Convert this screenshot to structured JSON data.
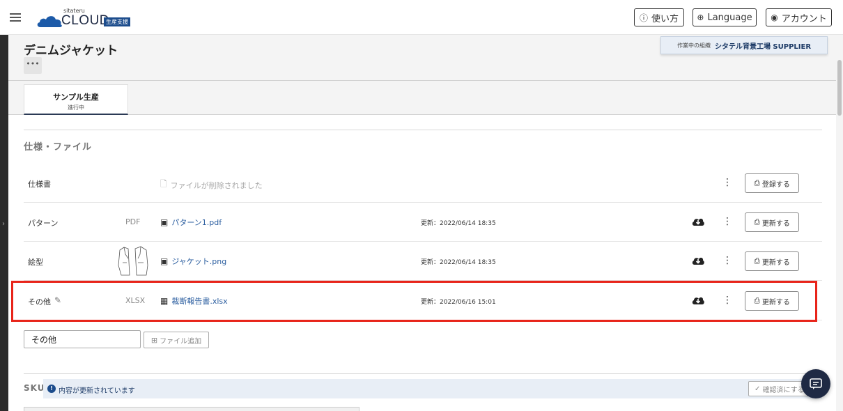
{
  "header": {
    "brand_small": "sitateru",
    "brand": "CLOUD",
    "badge": "生産支援",
    "help_label": "使い方",
    "language_label": "Language",
    "account_label": "アカウント"
  },
  "page": {
    "title": "デニムジャケット",
    "more_label": "•••",
    "org_label": "作業中の組織",
    "org_name": "シタテル背景工場 SUPPLIER"
  },
  "tabs": [
    {
      "label": "サンプル生産",
      "sub": "進行中"
    }
  ],
  "spec_section": {
    "title": "仕様・ファイル",
    "rows": [
      {
        "name": "仕様書",
        "type": "",
        "file": "ファイルが削除されました",
        "date": "",
        "button": "登録する"
      },
      {
        "name": "パターン",
        "type": "PDF",
        "file": "パターン1.pdf",
        "date": "更新：2022/06/14 18:35",
        "button": "更新する"
      },
      {
        "name": "絵型",
        "type": "",
        "file": "ジャケット.png",
        "date": "更新：2022/06/14 18:35",
        "button": "更新する"
      },
      {
        "name": "その他",
        "type": "XLSX",
        "file": "裁断報告書.xlsx",
        "date": "更新：2022/06/16 15:01",
        "button": "更新する"
      }
    ],
    "new_name_value": "その他",
    "add_file_label": "ファイル追加"
  },
  "sku_section": {
    "title": "SKU",
    "notice": "内容が更新されています",
    "confirm_label": "確認済にする"
  },
  "colors": {
    "navy": "#1f2a44",
    "link": "#2a5d9f",
    "highlight": "#e8241a",
    "notice_bg": "#e8eef6"
  }
}
